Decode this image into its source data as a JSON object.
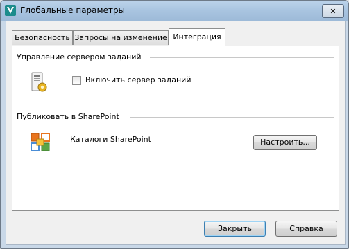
{
  "window": {
    "title": "Глобальные параметры",
    "close_label": "✕"
  },
  "tabs": [
    {
      "label": "Безопасность",
      "active": false
    },
    {
      "label": "Запросы на изменение",
      "active": false
    },
    {
      "label": "Интеграция",
      "active": true
    }
  ],
  "job_server": {
    "section_title": "Управление сервером заданий",
    "checkbox_label": "Включить сервер заданий",
    "checked": false,
    "icon": "job-server-icon"
  },
  "sharepoint": {
    "section_title": "Публиковать в SharePoint",
    "label": "Каталоги SharePoint",
    "configure_label": "Настроить...",
    "icon": "sharepoint-icon"
  },
  "footer": {
    "close_label": "Закрыть",
    "help_label": "Справка"
  }
}
